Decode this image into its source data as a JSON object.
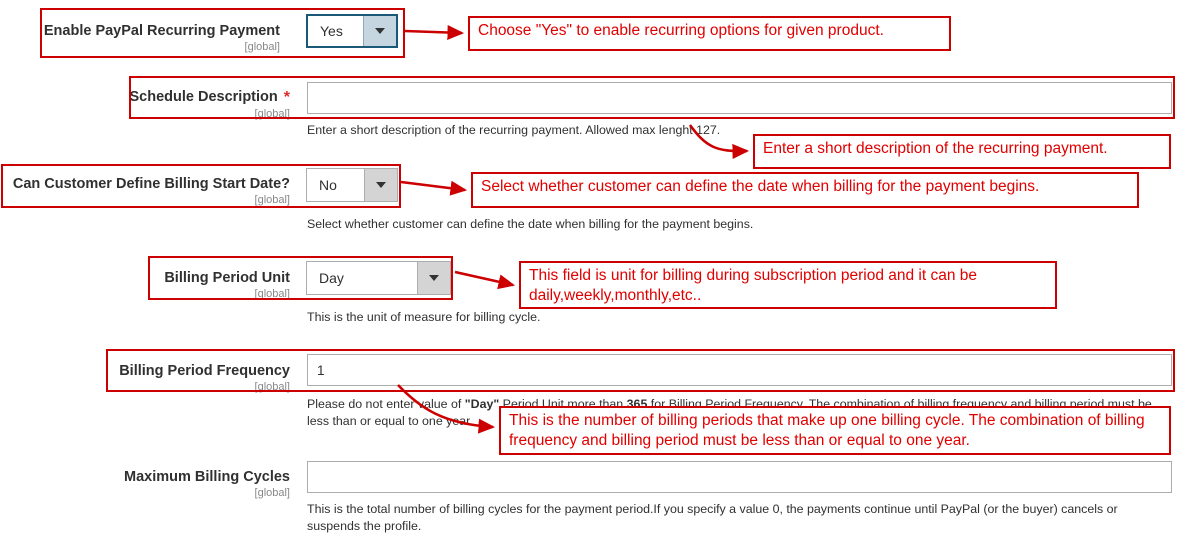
{
  "colors": {
    "annotation_red": "#cc0000",
    "annotation_text_red": "#e00000",
    "required_star": "#e02b27",
    "scope_gray": "#888888",
    "focus_blue": "#1a5a78"
  },
  "fields": [
    {
      "id": "enable-paypal-recurring-payment",
      "label": "Enable PayPal Recurring Payment",
      "scope": "[global]",
      "required": false,
      "control": "select",
      "value": "Yes",
      "focused": true,
      "hint": ""
    },
    {
      "id": "schedule-description",
      "label": "Schedule Description",
      "scope": "[global]",
      "required": true,
      "required_marker": "*",
      "control": "text",
      "value": "",
      "placeholder": "",
      "hint": "Enter a short description of the recurring payment. Allowed max lenght 127."
    },
    {
      "id": "can-customer-define-billing-start-date",
      "label": "Can Customer Define Billing Start Date?",
      "scope": "[global]",
      "required": false,
      "control": "select",
      "value": "No",
      "focused": false,
      "hint": "Select whether customer can define the date when billing for the payment begins."
    },
    {
      "id": "billing-period-unit",
      "label": "Billing Period Unit",
      "scope": "[global]",
      "required": false,
      "control": "select",
      "value": "Day",
      "focused": false,
      "hint": "This is the unit of measure for billing cycle."
    },
    {
      "id": "billing-period-frequency",
      "label": "Billing Period Frequency",
      "scope": "[global]",
      "required": false,
      "control": "text",
      "value": "1",
      "placeholder": "",
      "hint_parts": {
        "p1": "Please do not enter value of ",
        "b1": "\"Day\"",
        "p2": " Period Unit more than ",
        "b2": "365",
        "p3": " for Billing Period Frequency. The combination of billing frequency and billing period must be less than or equal to one year."
      }
    },
    {
      "id": "maximum-billing-cycles",
      "label": "Maximum Billing Cycles",
      "scope": "[global]",
      "required": false,
      "control": "text",
      "value": "",
      "placeholder": "",
      "hint": "This is the total number of billing cycles for the payment period.If you specify a value 0, the payments continue until PayPal (or the buyer) cancels or suspends the profile."
    }
  ],
  "annotations": [
    {
      "id": "annotation-enable-recurring",
      "text": "Choose \"Yes\" to enable recurring options for given product."
    },
    {
      "id": "annotation-schedule-description",
      "text": "Enter a short description of the recurring payment."
    },
    {
      "id": "annotation-billing-start-date",
      "text": "Select whether customer can define the date when billing for the payment begins."
    },
    {
      "id": "annotation-billing-period-unit",
      "text": "This field is unit for billing during subscription period and it can be daily,weekly,monthly,etc.."
    },
    {
      "id": "annotation-billing-period-frequency",
      "text": "This is the number of billing periods that make up one billing cycle. The combination of billing frequency and billing period must be less than or equal to one year."
    }
  ]
}
